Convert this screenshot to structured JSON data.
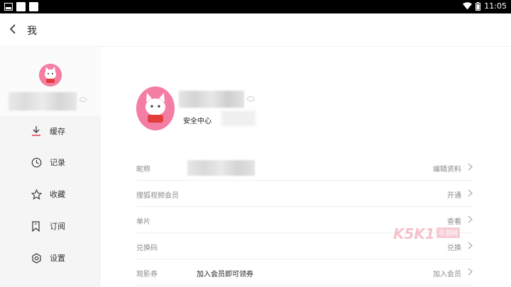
{
  "status": {
    "time": "11:05"
  },
  "header": {
    "title": "我"
  },
  "sidebar": {
    "items": [
      {
        "label": "缓存",
        "icon": "download-icon"
      },
      {
        "label": "记录",
        "icon": "clock-icon"
      },
      {
        "label": "收藏",
        "icon": "star-icon"
      },
      {
        "label": "订阅",
        "icon": "bookmark-icon"
      },
      {
        "label": "设置",
        "icon": "settings-icon"
      }
    ]
  },
  "profile": {
    "security_label": "安全中心"
  },
  "rows": [
    {
      "label": "昵称",
      "value": "编辑资料",
      "middle": ""
    },
    {
      "label": "搜狐视频会员",
      "value": "开通",
      "middle": ""
    },
    {
      "label": "单片",
      "value": "查看",
      "middle": ""
    },
    {
      "label": "兑换码",
      "value": "兑换",
      "middle": ""
    },
    {
      "label": "观影券",
      "value": "加入会员",
      "middle": "加入会员即可领券"
    }
  ],
  "watermark": {
    "main": "K5K1",
    "tag": "手游网"
  },
  "colors": {
    "accent": "#e0455f",
    "statusbar": "#000000",
    "muted_text": "#8a8a8a"
  }
}
